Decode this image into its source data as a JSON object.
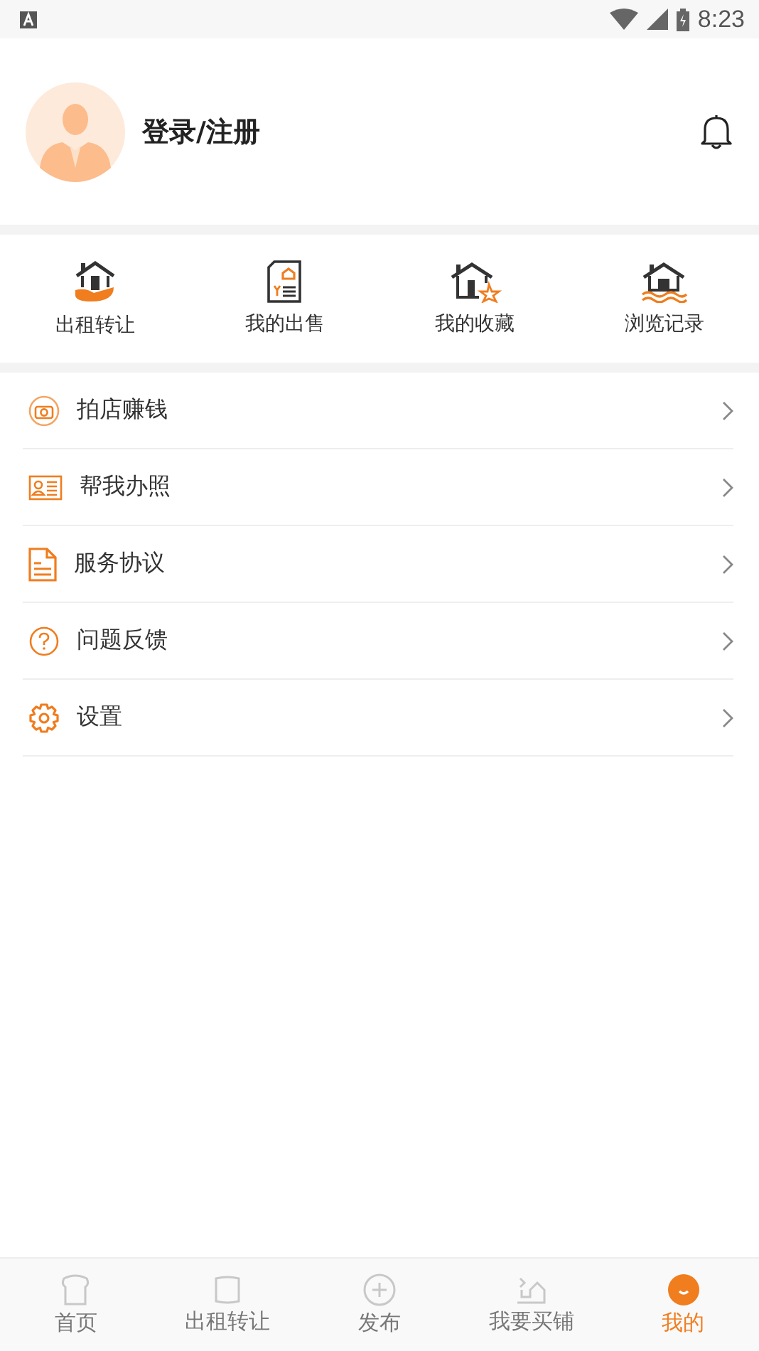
{
  "status_bar": {
    "time": "8:23"
  },
  "profile": {
    "login_label": "登录/注册"
  },
  "shortcuts": [
    {
      "label": "出租转让"
    },
    {
      "label": "我的出售"
    },
    {
      "label": "我的收藏"
    },
    {
      "label": "浏览记录"
    }
  ],
  "menu": [
    {
      "label": "拍店赚钱"
    },
    {
      "label": "帮我办照"
    },
    {
      "label": "服务协议"
    },
    {
      "label": "问题反馈"
    },
    {
      "label": "设置"
    }
  ],
  "tabs": [
    {
      "label": "首页",
      "selected": false
    },
    {
      "label": "出租转让",
      "selected": false
    },
    {
      "label": "发布",
      "selected": false
    },
    {
      "label": "我要买铺",
      "selected": false
    },
    {
      "label": "我的",
      "selected": true
    }
  ]
}
